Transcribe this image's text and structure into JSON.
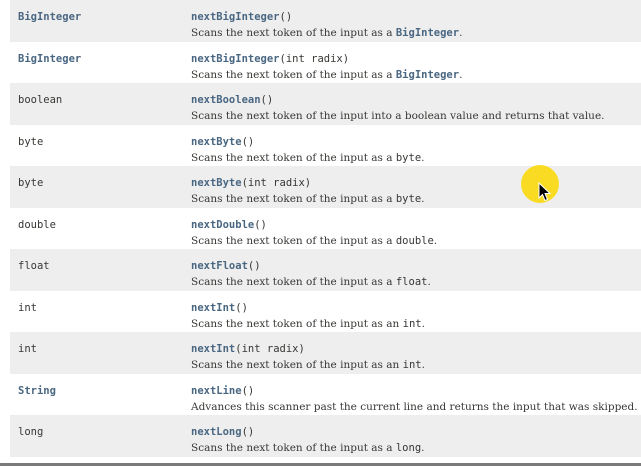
{
  "rows": [
    {
      "type": "BigInteger",
      "type_link": true,
      "method": "nextBigInteger",
      "params": "()",
      "desc_pre": "Scans the next token of the input as a ",
      "desc_code": "BigInteger",
      "desc_code_link": true,
      "desc_post": "."
    },
    {
      "type": "BigInteger",
      "type_link": true,
      "method": "nextBigInteger",
      "params": "(int radix)",
      "desc_pre": "Scans the next token of the input as a ",
      "desc_code": "BigInteger",
      "desc_code_link": true,
      "desc_post": "."
    },
    {
      "type": "boolean",
      "type_link": false,
      "method": "nextBoolean",
      "params": "()",
      "desc_pre": "Scans the next token of the input into a boolean value and returns that value.",
      "desc_code": "",
      "desc_code_link": false,
      "desc_post": ""
    },
    {
      "type": "byte",
      "type_link": false,
      "method": "nextByte",
      "params": "()",
      "desc_pre": "Scans the next token of the input as a ",
      "desc_code": "byte",
      "desc_code_link": false,
      "desc_post": "."
    },
    {
      "type": "byte",
      "type_link": false,
      "method": "nextByte",
      "params": "(int radix)",
      "desc_pre": "Scans the next token of the input as a ",
      "desc_code": "byte",
      "desc_code_link": false,
      "desc_post": "."
    },
    {
      "type": "double",
      "type_link": false,
      "method": "nextDouble",
      "params": "()",
      "desc_pre": "Scans the next token of the input as a ",
      "desc_code": "double",
      "desc_code_link": false,
      "desc_post": "."
    },
    {
      "type": "float",
      "type_link": false,
      "method": "nextFloat",
      "params": "()",
      "desc_pre": "Scans the next token of the input as a ",
      "desc_code": "float",
      "desc_code_link": false,
      "desc_post": "."
    },
    {
      "type": "int",
      "type_link": false,
      "method": "nextInt",
      "params": "()",
      "desc_pre": "Scans the next token of the input as an ",
      "desc_code": "int",
      "desc_code_link": false,
      "desc_post": "."
    },
    {
      "type": "int",
      "type_link": false,
      "method": "nextInt",
      "params": "(int radix)",
      "desc_pre": "Scans the next token of the input as an ",
      "desc_code": "int",
      "desc_code_link": false,
      "desc_post": "."
    },
    {
      "type": "String",
      "type_link": true,
      "method": "nextLine",
      "params": "()",
      "desc_pre": "Advances this scanner past the current line and returns the input that was skipped.",
      "desc_code": "",
      "desc_code_link": false,
      "desc_post": ""
    },
    {
      "type": "long",
      "type_link": false,
      "method": "nextLong",
      "params": "()",
      "desc_pre": "Scans the next token of the input as a ",
      "desc_code": "long",
      "desc_code_link": false,
      "desc_post": "."
    }
  ],
  "colors": {
    "link": "#4a6782",
    "text": "#353833",
    "row_alt": "#eeeeef",
    "cursor_halo": "#fad700"
  },
  "cursor": {
    "icon": "mouse-pointer-icon",
    "highlight": "cursor-highlight-halo"
  }
}
